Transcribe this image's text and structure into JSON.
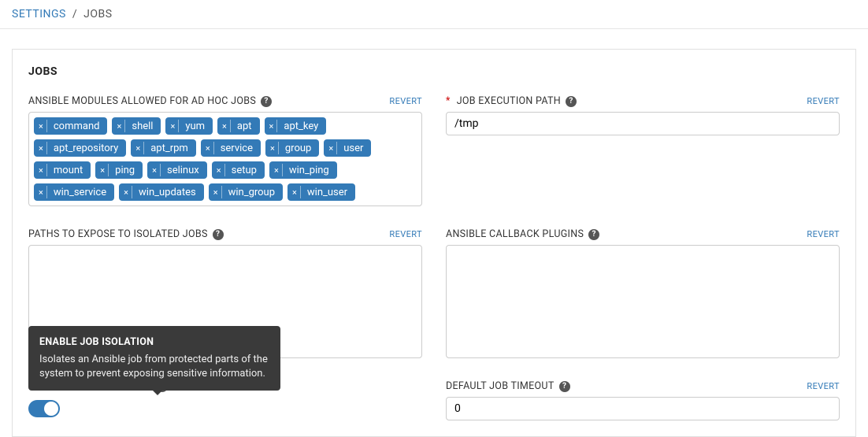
{
  "breadcrumb": {
    "parent": "SETTINGS",
    "current": "JOBS"
  },
  "panel": {
    "title": "JOBS"
  },
  "labels": {
    "modules": "ANSIBLE MODULES ALLOWED FOR AD HOC JOBS",
    "exec_path": "JOB EXECUTION PATH",
    "paths_expose": "PATHS TO EXPOSE TO ISOLATED JOBS",
    "callback_plugins": "ANSIBLE CALLBACK PLUGINS",
    "enable_isolation": "ENABLE JOB ISOLATION",
    "default_timeout": "DEFAULT JOB TIMEOUT",
    "revert": "REVERT"
  },
  "values": {
    "exec_path": "/tmp",
    "default_timeout": "0",
    "paths_expose": "",
    "callback_plugins": ""
  },
  "tags": [
    "command",
    "shell",
    "yum",
    "apt",
    "apt_key",
    "apt_repository",
    "apt_rpm",
    "service",
    "group",
    "user",
    "mount",
    "ping",
    "selinux",
    "setup",
    "win_ping",
    "win_service",
    "win_updates",
    "win_group",
    "win_user"
  ],
  "tooltip": {
    "title": "ENABLE JOB ISOLATION",
    "body": "Isolates an Ansible job from protected parts of the system to prevent exposing sensitive information."
  }
}
